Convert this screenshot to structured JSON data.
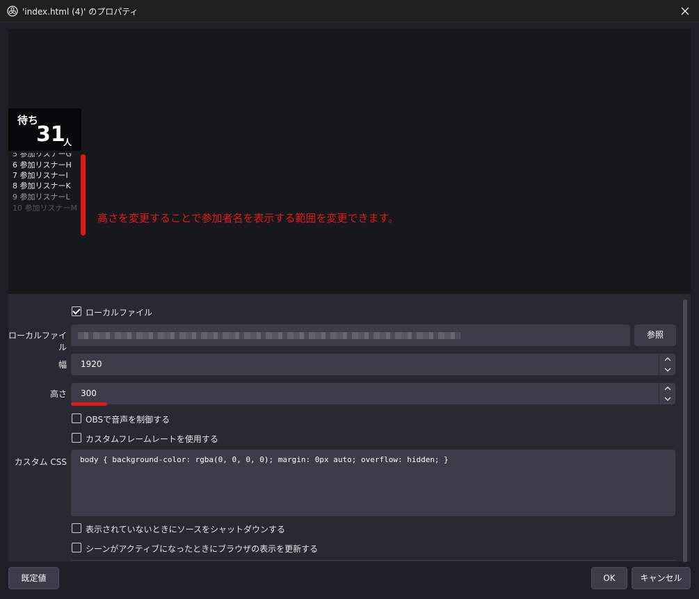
{
  "window": {
    "title": "'index.html (4)' のプロパティ"
  },
  "preview": {
    "wait_label": "待ち",
    "wait_count": "31",
    "wait_unit": "人",
    "listeners": [
      "5 参加リスナーG",
      "6 参加リスナーH",
      "7 参加リスナーI",
      "8 参加リスナーK",
      "9 参加リスナーL",
      "10 参加リスナーM"
    ],
    "annotation": "高さを変更することで参加者名を表示する範囲を変更できます。"
  },
  "form": {
    "local_file_checkbox": {
      "label": "ローカルファイル",
      "checked": true
    },
    "local_file": {
      "label": "ローカルファイル",
      "browse_label": "参照"
    },
    "width": {
      "label": "幅",
      "value": "1920"
    },
    "height": {
      "label": "高さ",
      "value": "300"
    },
    "obs_audio": {
      "label": "OBSで音声を制御する",
      "checked": false
    },
    "custom_fps": {
      "label": "カスタムフレームレートを使用する",
      "checked": false
    },
    "custom_css": {
      "label": "カスタム CSS",
      "value": "body { background-color: rgba(0, 0, 0, 0); margin: 0px auto; overflow: hidden; }"
    },
    "shutdown": {
      "label": "表示されていないときにソースをシャットダウンする",
      "checked": false
    },
    "refresh": {
      "label": "シーンがアクティブになったときにブラウザの表示を更新する",
      "checked": false
    }
  },
  "buttons": {
    "defaults": "既定値",
    "ok": "OK",
    "cancel": "キャンセル"
  },
  "colors": {
    "accent_red": "#e21818",
    "panel": "#272a33",
    "input": "#3b3e4a"
  }
}
